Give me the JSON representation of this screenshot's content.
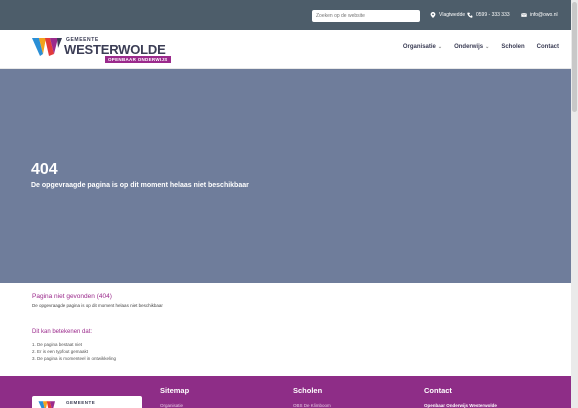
{
  "topbar": {
    "search_placeholder": "Zoeken op de website",
    "location": "Vlagtwedde",
    "phone": "0599 - 333 333",
    "email": "info@owo.nl"
  },
  "logo": {
    "small": "GEMEENTE",
    "big": "WESTERWOLDE",
    "tag": "OPENBAAR ONDERWIJS"
  },
  "nav": [
    {
      "label": "Organisatie",
      "dropdown": true
    },
    {
      "label": "Onderwijs",
      "dropdown": true
    },
    {
      "label": "Scholen",
      "dropdown": false
    },
    {
      "label": "Contact",
      "dropdown": false
    }
  ],
  "hero": {
    "code": "404",
    "message": "De opgevraagde pagina is op dit moment helaas niet beschikbaar"
  },
  "content": {
    "title": "Pagina niet gevonden (404)",
    "text": "De opgevraagde pagina is op dit moment helaas niet beschikbaar",
    "subtitle": "Dit kan betekenen dat:",
    "reasons": [
      "1. De pagina bestaat niet",
      "2. Er is een typfout gemaakt",
      "3. De pagina is momenteel in ontwikkeling"
    ]
  },
  "footer": {
    "logo_small": "GEMEENTE",
    "col1_title": "Sitemap",
    "col1_item": "Organisatie",
    "col2_title": "Scholen",
    "col2_item": "OBS De Klimboom",
    "col3_title": "Contact",
    "col3_item": "Openbaar Onderwijs Westerwolde"
  },
  "colors": {
    "topbar": "#4d5d6a",
    "hero": "#6f7d9b",
    "accent": "#9b2a8c",
    "footer": "#8e2d87"
  }
}
